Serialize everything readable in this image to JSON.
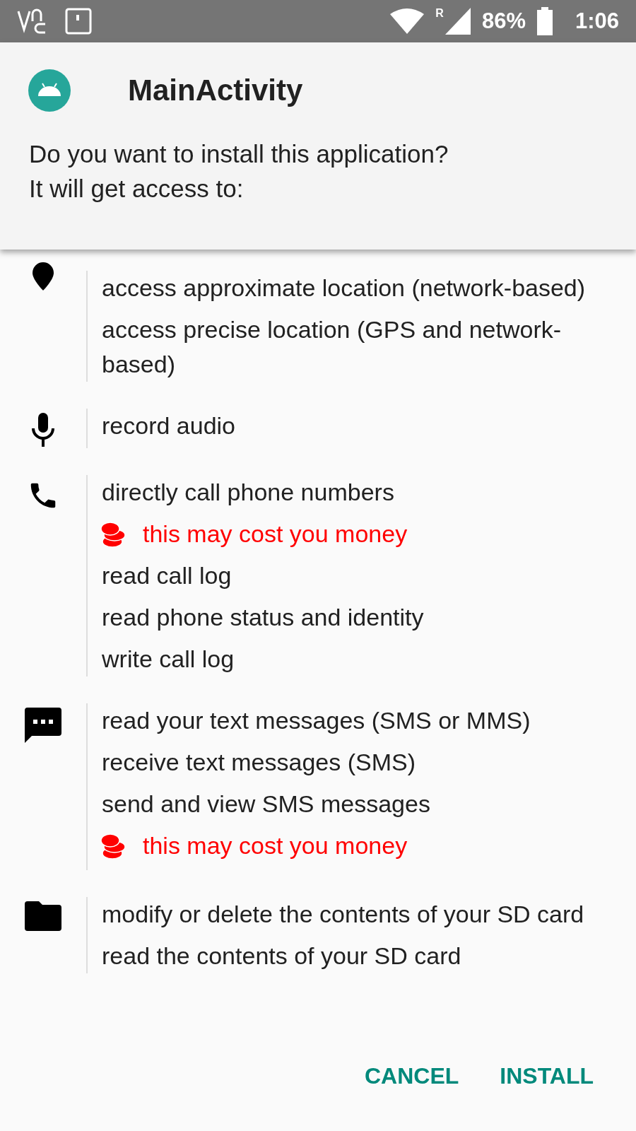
{
  "status_bar": {
    "roaming": "R",
    "battery": "86%",
    "time": "1:06"
  },
  "dialog": {
    "title": "MainActivity",
    "message_lines": [
      "Do you want to install this application?",
      "It will get access to:"
    ]
  },
  "permission_groups": [
    {
      "kind": "location",
      "items": [
        {
          "kind": "permission",
          "text": "access approximate location (network-based)"
        },
        {
          "kind": "permission",
          "text": "access precise location (GPS and network-based)"
        }
      ]
    },
    {
      "kind": "microphone",
      "items": [
        {
          "kind": "permission",
          "text": "record audio"
        }
      ]
    },
    {
      "kind": "phone",
      "items": [
        {
          "kind": "permission",
          "text": "directly call phone numbers"
        },
        {
          "kind": "warning",
          "text": "this may cost you money"
        },
        {
          "kind": "permission",
          "text": "read call log"
        },
        {
          "kind": "permission",
          "text": "read phone status and identity"
        },
        {
          "kind": "permission",
          "text": "write call log"
        }
      ]
    },
    {
      "kind": "messages",
      "items": [
        {
          "kind": "permission",
          "text": "read your text messages (SMS or MMS)"
        },
        {
          "kind": "permission",
          "text": "receive text messages (SMS)"
        },
        {
          "kind": "permission",
          "text": "send and view SMS messages"
        },
        {
          "kind": "warning",
          "text": "this may cost you money"
        }
      ]
    },
    {
      "kind": "storage",
      "items": [
        {
          "kind": "permission",
          "text": "modify or delete the contents of your SD card"
        },
        {
          "kind": "permission",
          "text": "read the contents of your SD card"
        }
      ]
    }
  ],
  "buttons": [
    "CANCEL",
    "INSTALL"
  ]
}
